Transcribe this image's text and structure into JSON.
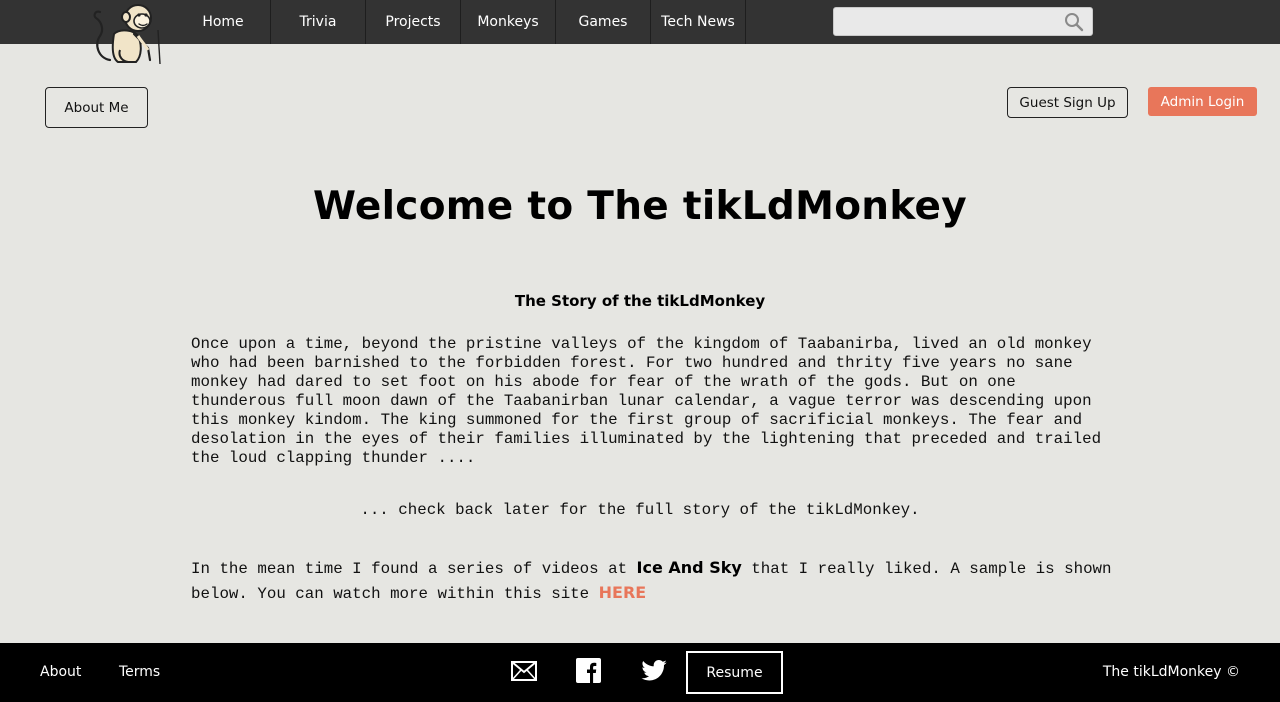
{
  "nav": {
    "items": [
      {
        "label": "Home"
      },
      {
        "label": "Trivia"
      },
      {
        "label": "Projects"
      },
      {
        "label": "Monkeys"
      },
      {
        "label": "Games"
      },
      {
        "label": "Tech News"
      }
    ],
    "search": {
      "value": "",
      "placeholder": ""
    }
  },
  "buttons": {
    "about_me": "About Me",
    "guest_signup": "Guest Sign Up",
    "admin_login": "Admin Login"
  },
  "main": {
    "title": "Welcome to The tikLdMonkey",
    "subtitle": "The Story of the tikLdMonkey",
    "story": "Once upon a time, beyond the pristine valleys of the kingdom of Taabanirba, lived an old monkey who had been barnished to the forbidden forest. For two hundred and thrity five years no sane monkey had dared to set foot on his abode for fear of the wrath of the gods. But on one thunderous full moon dawn of the Taabanirban lunar calendar, a vague terror was descending upon this monkey kindom. The king summoned for the first group of sacrificial monkeys. The fear and desolation in the eyes of their families illuminated by the lightening that preceded and trailed the loud clapping thunder ....",
    "check_back": "... check back later for the full story of the tikLdMonkey.",
    "meantime_before": "In the mean time I found a series of videos at ",
    "ice_and_sky": "Ice And Sky",
    "meantime_after": " that I really liked. A sample is shown below. You can watch more within this site ",
    "here": "HERE"
  },
  "footer": {
    "about": "About",
    "terms": "Terms",
    "resume": "Resume",
    "copyright": "The tikLdMonkey ©"
  },
  "colors": {
    "accent": "#e8765a",
    "nav_bg": "#333333",
    "page_bg": "#e6e6e2",
    "footer_bg": "#000000"
  },
  "icons": [
    "monkey-logo",
    "search-icon",
    "mail-icon",
    "facebook-icon",
    "twitter-icon"
  ]
}
